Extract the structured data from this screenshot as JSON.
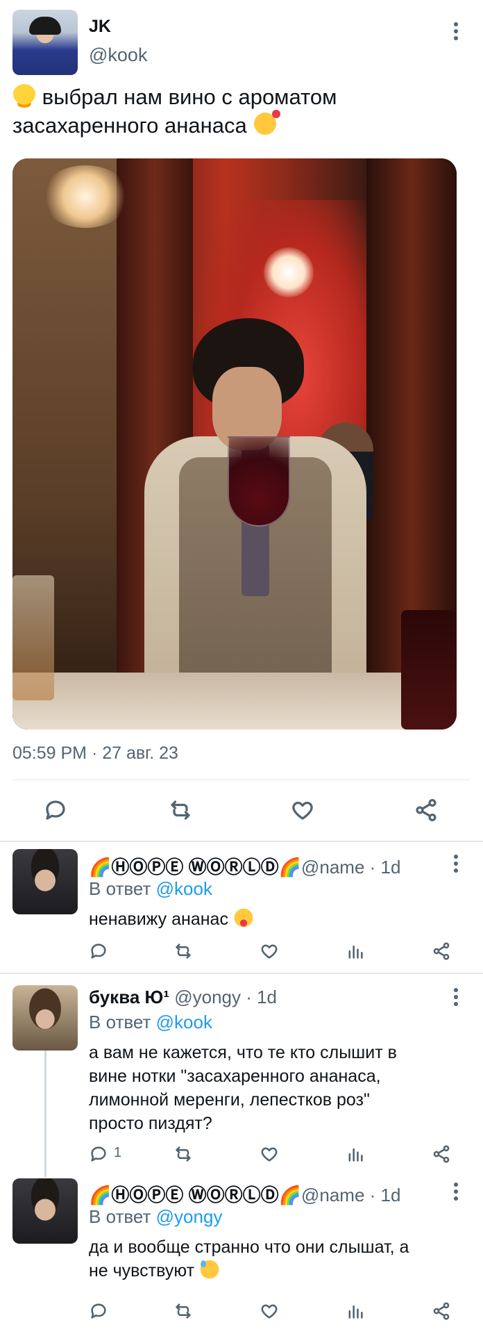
{
  "main_tweet": {
    "display_name": "JK",
    "handle": "@kook",
    "text_line1": " выбрал  нам вино с ароматом",
    "text_line2": "засахаренного ананаса ",
    "timestamp": "05:59 PM · 27 авг. 23",
    "emoji_start": "chick-emoji",
    "emoji_end": "smiling-face-with-hearts-emoji"
  },
  "replies": [
    {
      "display_name": "🌈ⒽⓄⓅⒺ ⓌⓄⓇⓁⒹ🌈",
      "meta": "@name · 1d",
      "reply_label": "В ответ ",
      "reply_to": "@kook",
      "text": "ненавижу ананас ",
      "emoji": "squinting-face-with-tongue-emoji",
      "reply_count": ""
    },
    {
      "display_name": "буква Ю¹",
      "meta": "@yongy · 1d",
      "reply_label": "В ответ ",
      "reply_to": "@kook",
      "text_lines": [
        "а вам не кажется,  что те кто слышит  в",
        "вине нотки \"засахаренного ананаса,",
        "лимонной меренги, лепестков роз\"",
        "просто пиздят?"
      ],
      "reply_count": "1"
    },
    {
      "display_name": "🌈ⒽⓄⓅⒺ ⓌⓄⓇⓁⒹ🌈",
      "meta": "@name · 1d",
      "reply_label": "В ответ ",
      "reply_to": "@yongy",
      "text_lines": [
        "да и вообще странно что они слышат,  а",
        "не чувствуют "
      ],
      "emoji": "grinning-face-with-sweat-emoji",
      "reply_count": ""
    }
  ]
}
